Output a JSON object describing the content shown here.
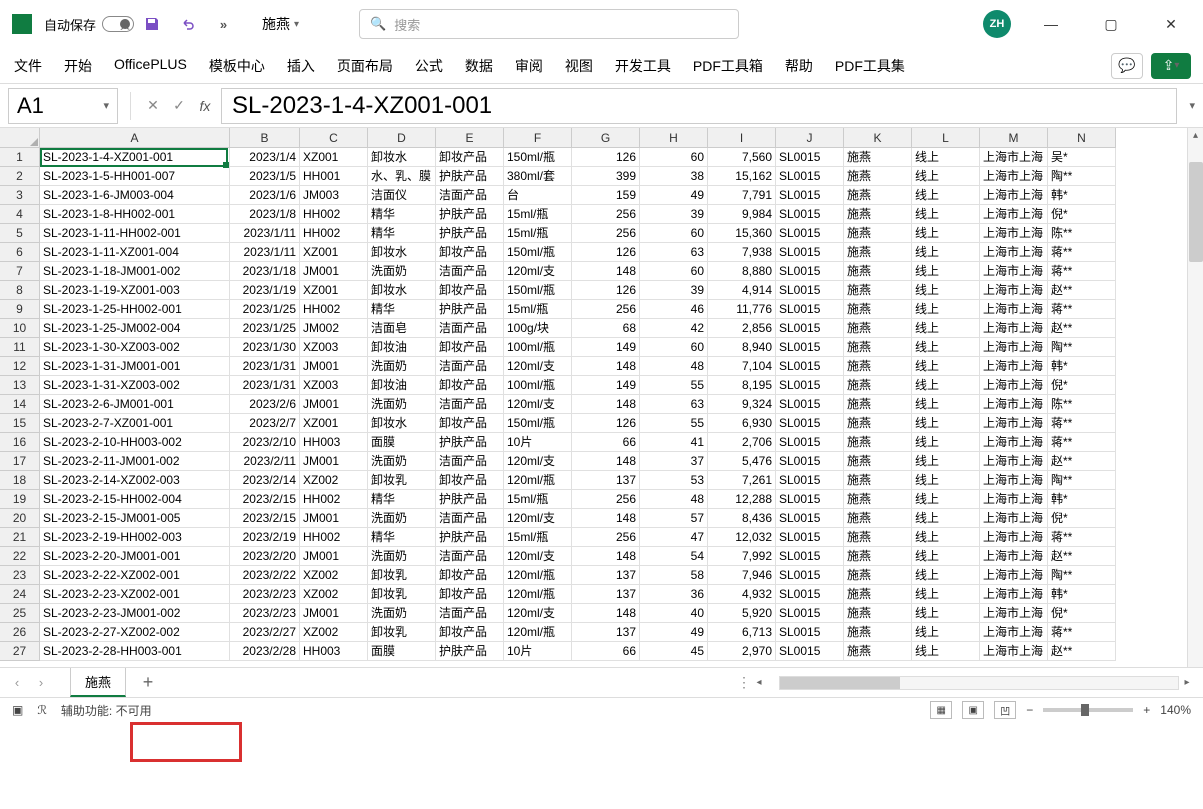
{
  "titlebar": {
    "autosave_label": "自动保存",
    "autosave_state": "关",
    "doc_name": "施燕",
    "search_placeholder": "搜索",
    "avatar": "ZH"
  },
  "ribbon": {
    "tabs": [
      "文件",
      "开始",
      "OfficePLUS",
      "模板中心",
      "插入",
      "页面布局",
      "公式",
      "数据",
      "审阅",
      "视图",
      "开发工具",
      "PDF工具箱",
      "帮助",
      "PDF工具集"
    ]
  },
  "formulabar": {
    "namebox": "A1",
    "formula": "SL-2023-1-4-XZ001-001"
  },
  "columns": [
    "A",
    "B",
    "C",
    "D",
    "E",
    "F",
    "G",
    "H",
    "I",
    "J",
    "K",
    "L",
    "M",
    "N"
  ],
  "col_widths": [
    "cA",
    "cB",
    "cC",
    "cD",
    "cE",
    "cF",
    "cG",
    "cH",
    "cI",
    "cJ",
    "cK",
    "cL",
    "cM",
    "cN"
  ],
  "rows": [
    {
      "n": 1,
      "c": [
        "SL-2023-1-4-XZ001-001",
        "2023/1/4",
        "XZ001",
        "卸妆水",
        "卸妆产品",
        "150ml/瓶",
        "126",
        "60",
        "7,560",
        "SL0015",
        "施燕",
        "线上",
        "上海市上海",
        "吴*"
      ]
    },
    {
      "n": 2,
      "c": [
        "SL-2023-1-5-HH001-007",
        "2023/1/5",
        "HH001",
        "水、乳、膜",
        "护肤产品",
        "380ml/套",
        "399",
        "38",
        "15,162",
        "SL0015",
        "施燕",
        "线上",
        "上海市上海",
        "陶**"
      ]
    },
    {
      "n": 3,
      "c": [
        "SL-2023-1-6-JM003-004",
        "2023/1/6",
        "JM003",
        "洁面仪",
        "洁面产品",
        "台",
        "159",
        "49",
        "7,791",
        "SL0015",
        "施燕",
        "线上",
        "上海市上海",
        "韩*"
      ]
    },
    {
      "n": 4,
      "c": [
        "SL-2023-1-8-HH002-001",
        "2023/1/8",
        "HH002",
        "精华",
        "护肤产品",
        "15ml/瓶",
        "256",
        "39",
        "9,984",
        "SL0015",
        "施燕",
        "线上",
        "上海市上海",
        "倪*"
      ]
    },
    {
      "n": 5,
      "c": [
        "SL-2023-1-11-HH002-001",
        "2023/1/11",
        "HH002",
        "精华",
        "护肤产品",
        "15ml/瓶",
        "256",
        "60",
        "15,360",
        "SL0015",
        "施燕",
        "线上",
        "上海市上海",
        "陈**"
      ]
    },
    {
      "n": 6,
      "c": [
        "SL-2023-1-11-XZ001-004",
        "2023/1/11",
        "XZ001",
        "卸妆水",
        "卸妆产品",
        "150ml/瓶",
        "126",
        "63",
        "7,938",
        "SL0015",
        "施燕",
        "线上",
        "上海市上海",
        "蒋**"
      ]
    },
    {
      "n": 7,
      "c": [
        "SL-2023-1-18-JM001-002",
        "2023/1/18",
        "JM001",
        "洗面奶",
        "洁面产品",
        "120ml/支",
        "148",
        "60",
        "8,880",
        "SL0015",
        "施燕",
        "线上",
        "上海市上海",
        "蒋**"
      ]
    },
    {
      "n": 8,
      "c": [
        "SL-2023-1-19-XZ001-003",
        "2023/1/19",
        "XZ001",
        "卸妆水",
        "卸妆产品",
        "150ml/瓶",
        "126",
        "39",
        "4,914",
        "SL0015",
        "施燕",
        "线上",
        "上海市上海",
        "赵**"
      ]
    },
    {
      "n": 9,
      "c": [
        "SL-2023-1-25-HH002-001",
        "2023/1/25",
        "HH002",
        "精华",
        "护肤产品",
        "15ml/瓶",
        "256",
        "46",
        "11,776",
        "SL0015",
        "施燕",
        "线上",
        "上海市上海",
        "蒋**"
      ]
    },
    {
      "n": 10,
      "c": [
        "SL-2023-1-25-JM002-004",
        "2023/1/25",
        "JM002",
        "洁面皂",
        "洁面产品",
        "100g/块",
        "68",
        "42",
        "2,856",
        "SL0015",
        "施燕",
        "线上",
        "上海市上海",
        "赵**"
      ]
    },
    {
      "n": 11,
      "c": [
        "SL-2023-1-30-XZ003-002",
        "2023/1/30",
        "XZ003",
        "卸妆油",
        "卸妆产品",
        "100ml/瓶",
        "149",
        "60",
        "8,940",
        "SL0015",
        "施燕",
        "线上",
        "上海市上海",
        "陶**"
      ]
    },
    {
      "n": 12,
      "c": [
        "SL-2023-1-31-JM001-001",
        "2023/1/31",
        "JM001",
        "洗面奶",
        "洁面产品",
        "120ml/支",
        "148",
        "48",
        "7,104",
        "SL0015",
        "施燕",
        "线上",
        "上海市上海",
        "韩*"
      ]
    },
    {
      "n": 13,
      "c": [
        "SL-2023-1-31-XZ003-002",
        "2023/1/31",
        "XZ003",
        "卸妆油",
        "卸妆产品",
        "100ml/瓶",
        "149",
        "55",
        "8,195",
        "SL0015",
        "施燕",
        "线上",
        "上海市上海",
        "倪*"
      ]
    },
    {
      "n": 14,
      "c": [
        "SL-2023-2-6-JM001-001",
        "2023/2/6",
        "JM001",
        "洗面奶",
        "洁面产品",
        "120ml/支",
        "148",
        "63",
        "9,324",
        "SL0015",
        "施燕",
        "线上",
        "上海市上海",
        "陈**"
      ]
    },
    {
      "n": 15,
      "c": [
        "SL-2023-2-7-XZ001-001",
        "2023/2/7",
        "XZ001",
        "卸妆水",
        "卸妆产品",
        "150ml/瓶",
        "126",
        "55",
        "6,930",
        "SL0015",
        "施燕",
        "线上",
        "上海市上海",
        "蒋**"
      ]
    },
    {
      "n": 16,
      "c": [
        "SL-2023-2-10-HH003-002",
        "2023/2/10",
        "HH003",
        "面膜",
        "护肤产品",
        "10片",
        "66",
        "41",
        "2,706",
        "SL0015",
        "施燕",
        "线上",
        "上海市上海",
        "蒋**"
      ]
    },
    {
      "n": 17,
      "c": [
        "SL-2023-2-11-JM001-002",
        "2023/2/11",
        "JM001",
        "洗面奶",
        "洁面产品",
        "120ml/支",
        "148",
        "37",
        "5,476",
        "SL0015",
        "施燕",
        "线上",
        "上海市上海",
        "赵**"
      ]
    },
    {
      "n": 18,
      "c": [
        "SL-2023-2-14-XZ002-003",
        "2023/2/14",
        "XZ002",
        "卸妆乳",
        "卸妆产品",
        "120ml/瓶",
        "137",
        "53",
        "7,261",
        "SL0015",
        "施燕",
        "线上",
        "上海市上海",
        "陶**"
      ]
    },
    {
      "n": 19,
      "c": [
        "SL-2023-2-15-HH002-004",
        "2023/2/15",
        "HH002",
        "精华",
        "护肤产品",
        "15ml/瓶",
        "256",
        "48",
        "12,288",
        "SL0015",
        "施燕",
        "线上",
        "上海市上海",
        "韩*"
      ]
    },
    {
      "n": 20,
      "c": [
        "SL-2023-2-15-JM001-005",
        "2023/2/15",
        "JM001",
        "洗面奶",
        "洁面产品",
        "120ml/支",
        "148",
        "57",
        "8,436",
        "SL0015",
        "施燕",
        "线上",
        "上海市上海",
        "倪*"
      ]
    },
    {
      "n": 21,
      "c": [
        "SL-2023-2-19-HH002-003",
        "2023/2/19",
        "HH002",
        "精华",
        "护肤产品",
        "15ml/瓶",
        "256",
        "47",
        "12,032",
        "SL0015",
        "施燕",
        "线上",
        "上海市上海",
        "蒋**"
      ]
    },
    {
      "n": 22,
      "c": [
        "SL-2023-2-20-JM001-001",
        "2023/2/20",
        "JM001",
        "洗面奶",
        "洁面产品",
        "120ml/支",
        "148",
        "54",
        "7,992",
        "SL0015",
        "施燕",
        "线上",
        "上海市上海",
        "赵**"
      ]
    },
    {
      "n": 23,
      "c": [
        "SL-2023-2-22-XZ002-001",
        "2023/2/22",
        "XZ002",
        "卸妆乳",
        "卸妆产品",
        "120ml/瓶",
        "137",
        "58",
        "7,946",
        "SL0015",
        "施燕",
        "线上",
        "上海市上海",
        "陶**"
      ]
    },
    {
      "n": 24,
      "c": [
        "SL-2023-2-23-XZ002-001",
        "2023/2/23",
        "XZ002",
        "卸妆乳",
        "卸妆产品",
        "120ml/瓶",
        "137",
        "36",
        "4,932",
        "SL0015",
        "施燕",
        "线上",
        "上海市上海",
        "韩*"
      ]
    },
    {
      "n": 25,
      "c": [
        "SL-2023-2-23-JM001-002",
        "2023/2/23",
        "JM001",
        "洗面奶",
        "洁面产品",
        "120ml/支",
        "148",
        "40",
        "5,920",
        "SL0015",
        "施燕",
        "线上",
        "上海市上海",
        "倪*"
      ]
    },
    {
      "n": 26,
      "c": [
        "SL-2023-2-27-XZ002-002",
        "2023/2/27",
        "XZ002",
        "卸妆乳",
        "卸妆产品",
        "120ml/瓶",
        "137",
        "49",
        "6,713",
        "SL0015",
        "施燕",
        "线上",
        "上海市上海",
        "蒋**"
      ]
    },
    {
      "n": 27,
      "c": [
        "SL-2023-2-28-HH003-001",
        "2023/2/28",
        "HH003",
        "面膜",
        "护肤产品",
        "10片",
        "66",
        "45",
        "2,970",
        "SL0015",
        "施燕",
        "线上",
        "上海市上海",
        "赵**"
      ]
    }
  ],
  "sheet": {
    "active_tab": "施燕"
  },
  "statusbar": {
    "accessibility": "辅助功能: 不可用",
    "zoom": "140%"
  }
}
